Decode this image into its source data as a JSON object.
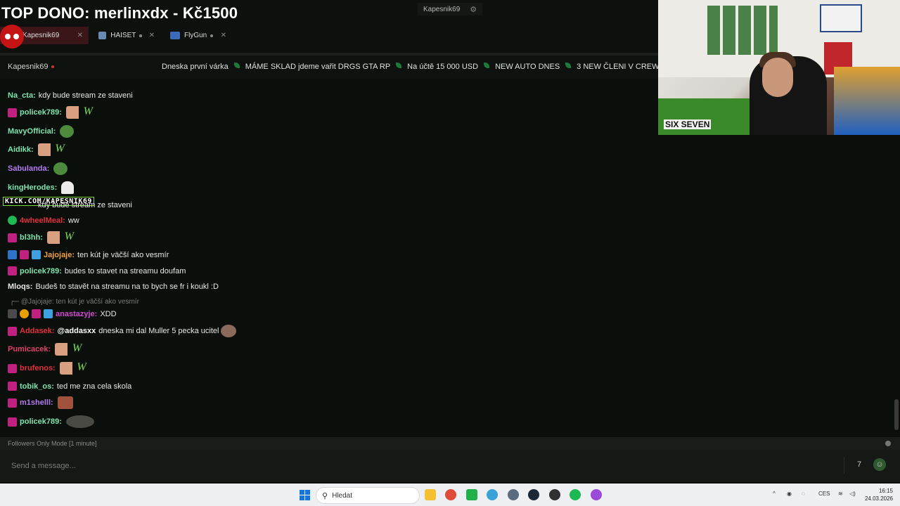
{
  "header": {
    "title": "TOP DONO: merlinxdx - Kč1500",
    "center_channel": "Kapesnik69",
    "tabs": [
      {
        "label": "Kapesnik69",
        "active": true
      },
      {
        "label": "HAISET",
        "active": false
      },
      {
        "label": "FlyGun",
        "active": false
      }
    ]
  },
  "chat_header": {
    "channel": "Kapesnik69",
    "ticker": [
      "Dneska první várka",
      "MÁME SKLAD jdeme vařit DRGS GTA RP",
      "Na účtě 15 000 USD",
      "NEW AUTO DNES",
      "3 NEW ČLENI V CREW"
    ]
  },
  "overlay_link": "KICK.COM/KAPESNIK69",
  "messages": [
    {
      "user": "Na_cta:",
      "color": "#7fe3b0",
      "text": "kdy bude stream ze staveni"
    },
    {
      "user": "policek789:",
      "color": "#7fe3b0",
      "text": ""
    },
    {
      "user": "MavyOfficial:",
      "color": "#7fe3b0",
      "text": ""
    },
    {
      "user": "Aidikk:",
      "color": "#7fe3b0",
      "text": ""
    },
    {
      "user": "Sabulanda:",
      "color": "#b57af0",
      "text": ""
    },
    {
      "user": "kingHerodes:",
      "color": "#7fe3b0",
      "text": ""
    },
    {
      "user": "",
      "color": "#cfcfcf",
      "text": "kdy bude stream ze staveni"
    },
    {
      "user": "4wheelMeal:",
      "color": "#e0303a",
      "text": "ww"
    },
    {
      "user": "bl3hh:",
      "color": "#7fe3b0",
      "text": ""
    },
    {
      "user": "Jajojaje:",
      "color": "#f0a040",
      "text": "ten kút je väčší ako vesmír"
    },
    {
      "user": "policek789:",
      "color": "#7fe3b0",
      "text": "budes to stavet na streamu doufam"
    },
    {
      "user": "Mloqs:",
      "color": "#e8e8e8",
      "text": "Budeš to stavět na streamu na to bych se fr i koukl :D"
    },
    {
      "user": "anastazyje:",
      "color": "#d04ad0",
      "text": "XDD"
    },
    {
      "user": "Addasek:",
      "color": "#e0303a",
      "text": "dneska mi dal Muller 5 pecka ucitel"
    },
    {
      "user": "Pumicacek:",
      "color": "#e0406a",
      "text": ""
    },
    {
      "user": "brufenos:",
      "color": "#e0303a",
      "text": ""
    },
    {
      "user": "tobik_os:",
      "color": "#7fe3b0",
      "text": "ted me zna cela skola"
    },
    {
      "user": "m1shelll:",
      "color": "#b57af0",
      "text": ""
    },
    {
      "user": "policek789:",
      "color": "#7fe3b0",
      "text": ""
    }
  ],
  "reply": {
    "handle": "@Jajojaje:",
    "text": "ten kút je väčší ako vesmír"
  },
  "mention": "@addasxx",
  "follow_mode": "Followers Only Mode [1 minute]",
  "input": {
    "placeholder": "Send a message..."
  },
  "taskbar": {
    "search_placeholder": "Hledat",
    "lang": "CES",
    "time": "16:15",
    "date": "24.03.2026"
  }
}
